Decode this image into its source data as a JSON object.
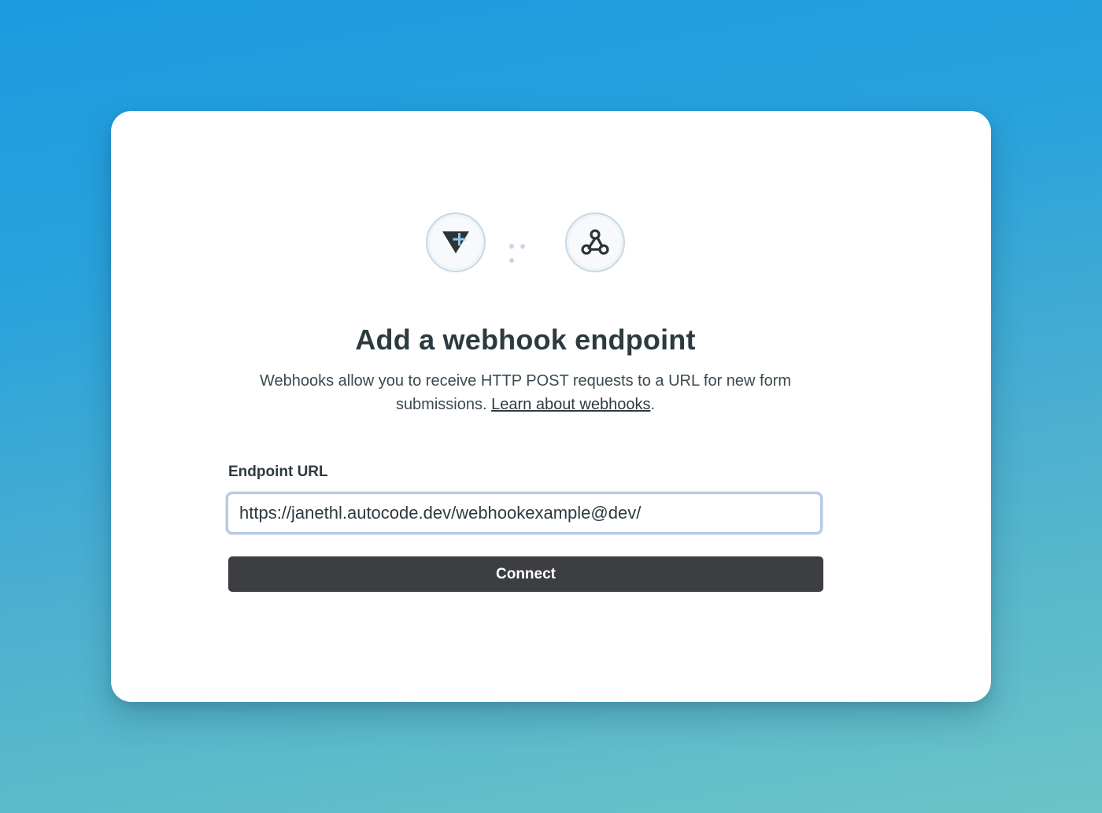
{
  "dialog": {
    "title": "Add a webhook endpoint",
    "description": "Webhooks allow you to receive HTTP POST requests to a URL for new form submissions.",
    "learn_link": "Learn about webhooks",
    "description_end": "."
  },
  "icons": {
    "left": "typeform-plus-icon",
    "connector": "ellipsis-connector",
    "right": "webhook-icon"
  },
  "form": {
    "endpoint_label": "Endpoint URL",
    "endpoint_value": "https://janethl.autocode.dev/webhookexample@dev/"
  },
  "actions": {
    "connect_label": "Connect"
  },
  "colors": {
    "button": "#3c3e42",
    "title": "#2d3a40",
    "input_focus_border": "#b7cbe3"
  }
}
